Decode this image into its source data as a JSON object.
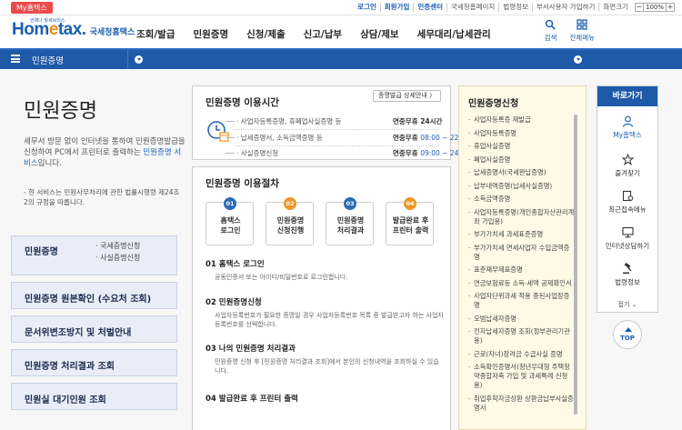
{
  "top": {
    "my_tag": "My홈택스",
    "util_links": [
      "로그인",
      "회원가입",
      "인증센터",
      "국세청홈페이지",
      "법령정보",
      "부서사용자 가입하기",
      "화면크기"
    ],
    "zoom_minus": "−",
    "zoom_value": "100%",
    "zoom_plus": "+"
  },
  "header": {
    "logo_main": "Hom",
    "logo_accent": "e",
    "logo_tail": "tax.",
    "logo_sub": "국세청홈택스",
    "logo_tiny": "언제나 빛세브리스",
    "nav": [
      "조회/발급",
      "민원증명",
      "신청/제출",
      "신고/납부",
      "상담/제보",
      "세무대리/납세관리"
    ],
    "search_label": "검색",
    "menu_label": "전체메뉴"
  },
  "breadcrumb": {
    "title": "민원증명"
  },
  "left": {
    "title": "민원증명",
    "desc_before": "세무서 방문 없이 인터넷을 통하여 민원증명발급을 신청하여 PC에서 프린터로 출력하는 ",
    "desc_highlight": "민원증명 서비스",
    "desc_after": "입니다.",
    "note": "- 현 서비스는 민원사무처리에 관한 법률시행령 제24조2의 규정을 따릅니다.",
    "menus": [
      {
        "label": "민원증명",
        "subs": [
          "· 국세증명신청",
          "· 사실증명신청"
        ]
      },
      {
        "label": "민원증명 원본확인 (수요처 조회)"
      },
      {
        "label": "문서위변조방지 및 처벌안내"
      },
      {
        "label": "민원증명 처리결과 조회"
      },
      {
        "label": "민원실 대기인원 조회"
      }
    ]
  },
  "hours": {
    "title": "민원증명 이용시간",
    "guide_button": "증명발급 상세안내 〉",
    "rows": [
      {
        "label": "사업자등록증명, 휴폐업사실증명 등",
        "time_bold": "연중무휴 24시간",
        "time_blue": ""
      },
      {
        "label": "납세증명서, 소득금액증명 등",
        "time_bold": "연중무휴 ",
        "time_blue": "08:00 ~ 22:00"
      },
      {
        "label": "사실증명신청",
        "time_bold": "연중무휴 ",
        "time_blue": "09:00 ~ 24:00"
      }
    ]
  },
  "process": {
    "title": "민원증명 이용절차",
    "steps": [
      {
        "num": "01",
        "line1": "홈택스",
        "line2": "로그인",
        "color": "#2a6db5"
      },
      {
        "num": "02",
        "line1": "민원증명",
        "line2": "신청진행",
        "color": "#f0962a"
      },
      {
        "num": "03",
        "line1": "민원증명",
        "line2": "처리결과",
        "color": "#2a6db5"
      },
      {
        "num": "04",
        "line1": "발급완료 후",
        "line2": "프린터 출력",
        "color": "#f0962a"
      }
    ],
    "items": [
      {
        "title": "01 홈택스 로그인",
        "desc": "공동인증서 또는 아이디/비밀번호로 로그인합니다."
      },
      {
        "title": "02 민원증명신청",
        "desc": "사업자등록번호가 필요한 증명일 경우 사업자등록번호 목록 중 발급받고자 하는 사업자등록번호를 선택합니다."
      },
      {
        "title": "03 나의 민원증명 처리결과",
        "desc": "민원증명 신청 후 [민원증명 처리결과 조회]에서 본인의 신청내역을 조회하실 수 있습니다."
      },
      {
        "title": "04 발급완료 후 프린터 출력",
        "desc": ""
      }
    ]
  },
  "apply_list": {
    "title": "민원증명신청",
    "items": [
      "사업자등록증 재발급",
      "사업자등록증명",
      "휴업사실증명",
      "폐업사실증명",
      "납세증명서(국세완납증명)",
      "납부내역증명(납세사실증명)",
      "소득금액증명",
      "사업자등록증명(개인종합자산관리계좌 가입용)",
      "부가가치세 과세표준증명",
      "부가가치세 면세사업자 수입금액증명",
      "표준재무제표증명",
      "연금보험료등 소득·세액 공제확인서",
      "사업자단위과세 적용 종된사업장증명",
      "모범납세자증명",
      "전자납세자증명 조회(정부관리기관용)",
      "근로(자녀)장려금 수급사실 증명",
      "소득확인증명서(청년우대형 주택청약종합저축 가입 및 과세특례 신청용)",
      "취업후학자금상환 상환금납부사실증명서"
    ]
  },
  "quick": {
    "header": "바로가기",
    "items": [
      "My홈택스",
      "즐겨찾기",
      "최근접속메뉴",
      "인터넷상담하기",
      "법령정보"
    ],
    "fold": "접기 ⌄",
    "top": "TOP"
  }
}
